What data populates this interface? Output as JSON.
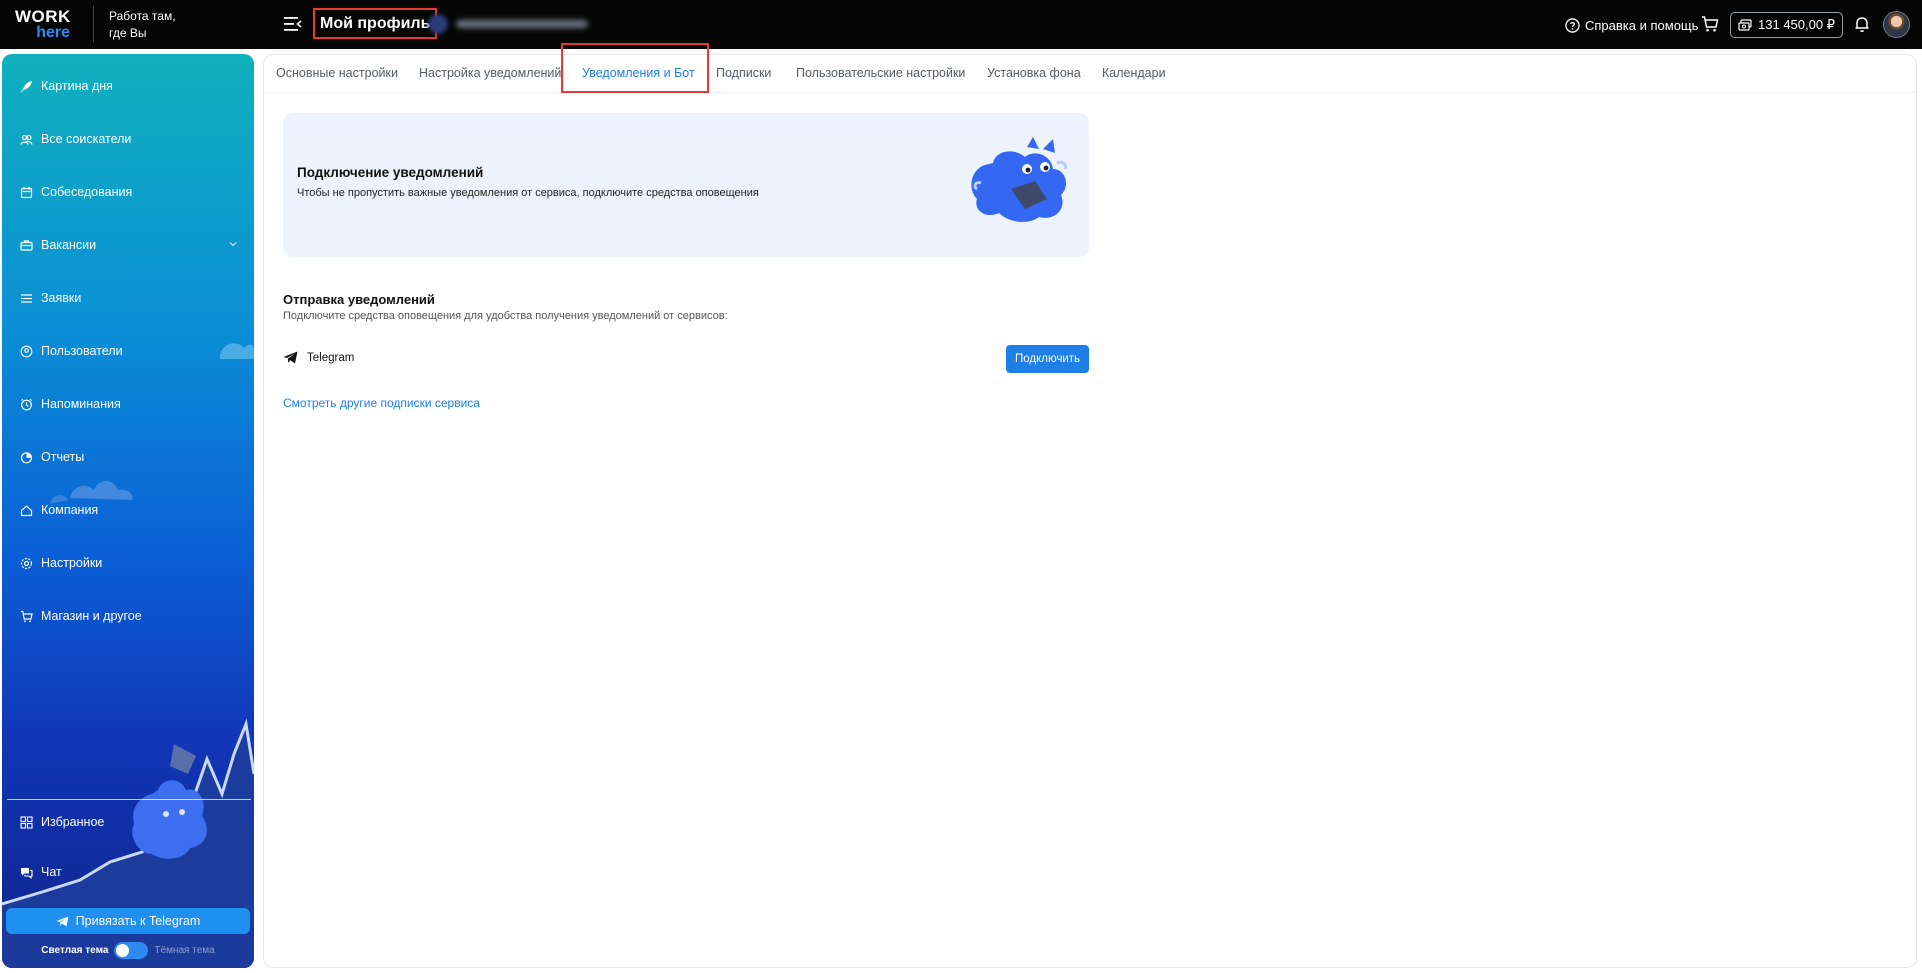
{
  "header": {
    "logo_top": "WORK",
    "logo_bottom": "here",
    "tagline_line1": "Работа там,",
    "tagline_line2": "где Вы",
    "page_title": "Мой профиль",
    "help_label": "Справка и помощь",
    "balance": "131 450,00 ₽"
  },
  "sidebar": {
    "items": [
      {
        "label": "Картина дня",
        "icon": "rocket-icon"
      },
      {
        "label": "Все соискатели",
        "icon": "people-icon"
      },
      {
        "label": "Собеседования",
        "icon": "calendar-icon"
      },
      {
        "label": "Вакансии",
        "icon": "briefcase-icon"
      },
      {
        "label": "Заявки",
        "icon": "list-icon"
      },
      {
        "label": "Пользователи",
        "icon": "user-circle-icon"
      },
      {
        "label": "Напоминания",
        "icon": "alarm-icon"
      },
      {
        "label": "Отчеты",
        "icon": "pie-chart-icon"
      },
      {
        "label": "Компания",
        "icon": "home-icon"
      },
      {
        "label": "Настройки",
        "icon": "gear-icon"
      },
      {
        "label": "Магазин и другое",
        "icon": "cart-icon"
      }
    ],
    "bottom_items": [
      {
        "label": "Избранное",
        "icon": "grid-icon"
      },
      {
        "label": "Чат",
        "icon": "chat-icon"
      }
    ],
    "telegram_button": "Привязать к Telegram",
    "theme_light": "Светлая тема",
    "theme_dark": "Тёмная тема"
  },
  "tabs": [
    {
      "label": "Основные настройки"
    },
    {
      "label": "Настройка уведомлений"
    },
    {
      "label": "Уведомления и Бот",
      "active": true
    },
    {
      "label": "Подписки"
    },
    {
      "label": "Пользовательские настройки"
    },
    {
      "label": "Установка фона"
    },
    {
      "label": "Календари"
    }
  ],
  "banner": {
    "title": "Подключение уведомлений",
    "text": "Чтобы не пропустить важные уведомления от сервиса, подключите средства оповещения"
  },
  "sending": {
    "title": "Отправка уведомлений",
    "subtitle": "Подключите средства оповещения для удобства получения уведомлений от сервисов:",
    "channel": "Telegram",
    "connect_button": "Подключить",
    "more_link": "Смотреть другие подписки сервиса"
  },
  "colors": {
    "accent": "#1e7fe6",
    "highlight": "#e53935",
    "topbar": "#050505",
    "banner_bg": "#edf3fc"
  }
}
